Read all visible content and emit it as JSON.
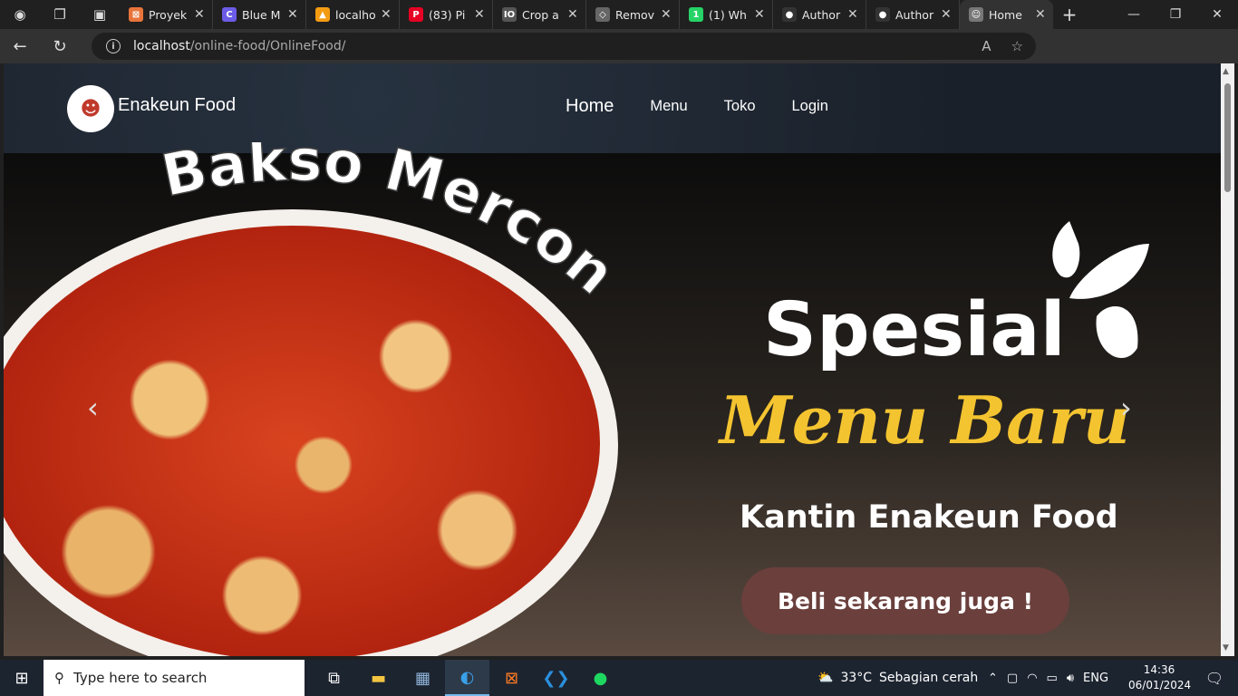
{
  "browser": {
    "tabs": [
      {
        "title": "Proyek",
        "color": "#e8743b",
        "glyph": "⊠"
      },
      {
        "title": "Blue M",
        "color": "#6b5ce7",
        "glyph": "C"
      },
      {
        "title": "localho",
        "color": "#f39c12",
        "glyph": "▲"
      },
      {
        "title": "(83) Pi",
        "color": "#e60023",
        "glyph": "P"
      },
      {
        "title": "Crop a",
        "color": "#555555",
        "glyph": "IO"
      },
      {
        "title": "Remov",
        "color": "#666666",
        "glyph": "◇"
      },
      {
        "title": "(1) Wh",
        "color": "#25d366",
        "glyph": "1"
      },
      {
        "title": "Author",
        "color": "#333333",
        "glyph": "●"
      },
      {
        "title": "Author",
        "color": "#333333",
        "glyph": "●"
      },
      {
        "title": "Home",
        "color": "#777777",
        "glyph": "☺",
        "active": true
      }
    ],
    "url_host": "localhost",
    "url_path": "/online-food/OnlineFood/"
  },
  "site": {
    "brand": "Enakeun Food",
    "nav": [
      "Home",
      "Menu",
      "Toko",
      "Login"
    ]
  },
  "hero": {
    "headline_arc": "Bakso Mercon",
    "title": "Spesial",
    "subtitle": "Menu Baru",
    "tagline": "Kantin Enakeun Food",
    "cta": "Beli sekarang juga !"
  },
  "taskbar": {
    "search_placeholder": "Type here to search",
    "weather_temp": "33°C",
    "weather_desc": "Sebagian cerah",
    "lang": "ENG",
    "time": "14:36",
    "date": "06/01/2024"
  }
}
